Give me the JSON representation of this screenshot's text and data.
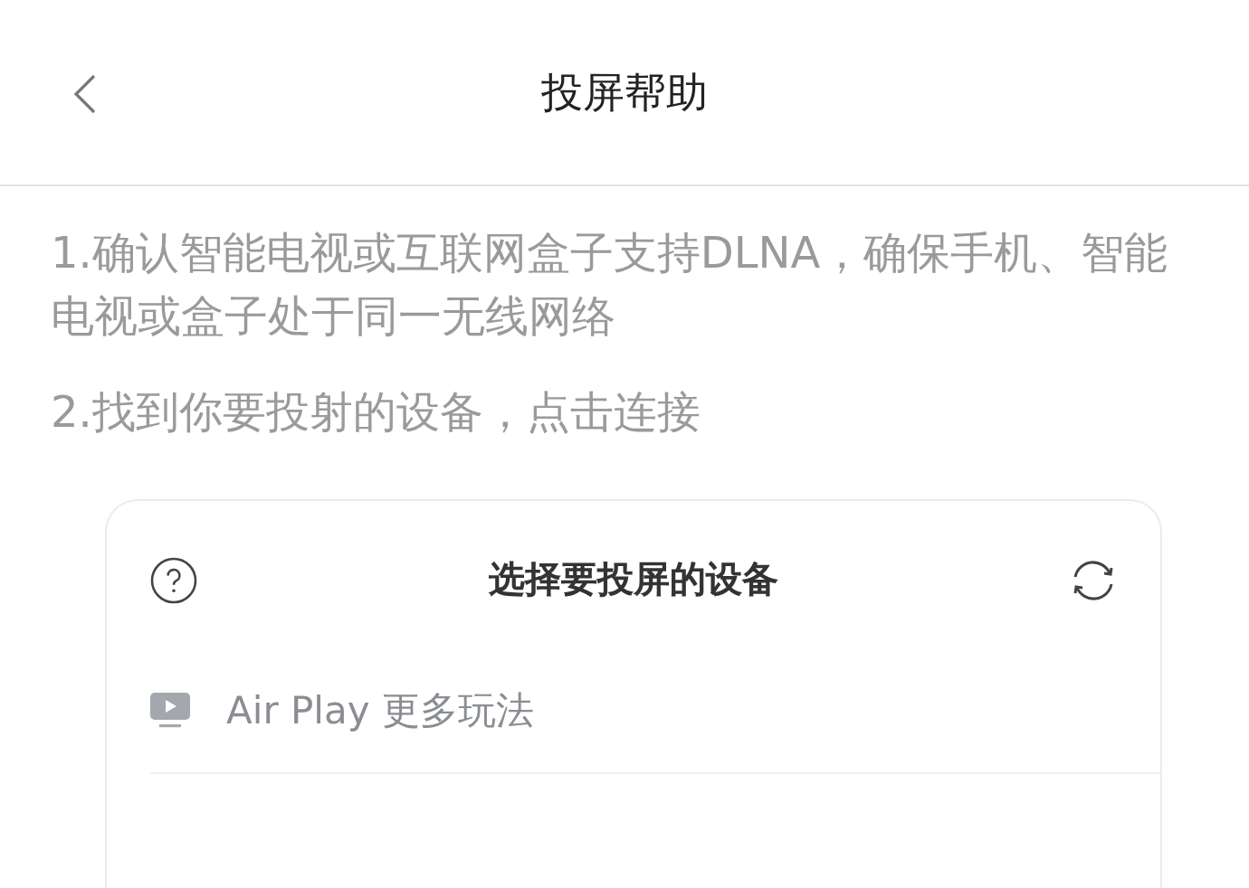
{
  "header": {
    "title": "投屏帮助"
  },
  "steps": [
    "1.确认智能电视或互联网盒子支持DLNA，确保手机、智能电视或盒子处于同一无线网络",
    "2.找到你要投射的设备，点击连接"
  ],
  "device_panel": {
    "title": "选择要投屏的设备",
    "items": [
      {
        "label": "Air Play 更多玩法"
      }
    ]
  }
}
